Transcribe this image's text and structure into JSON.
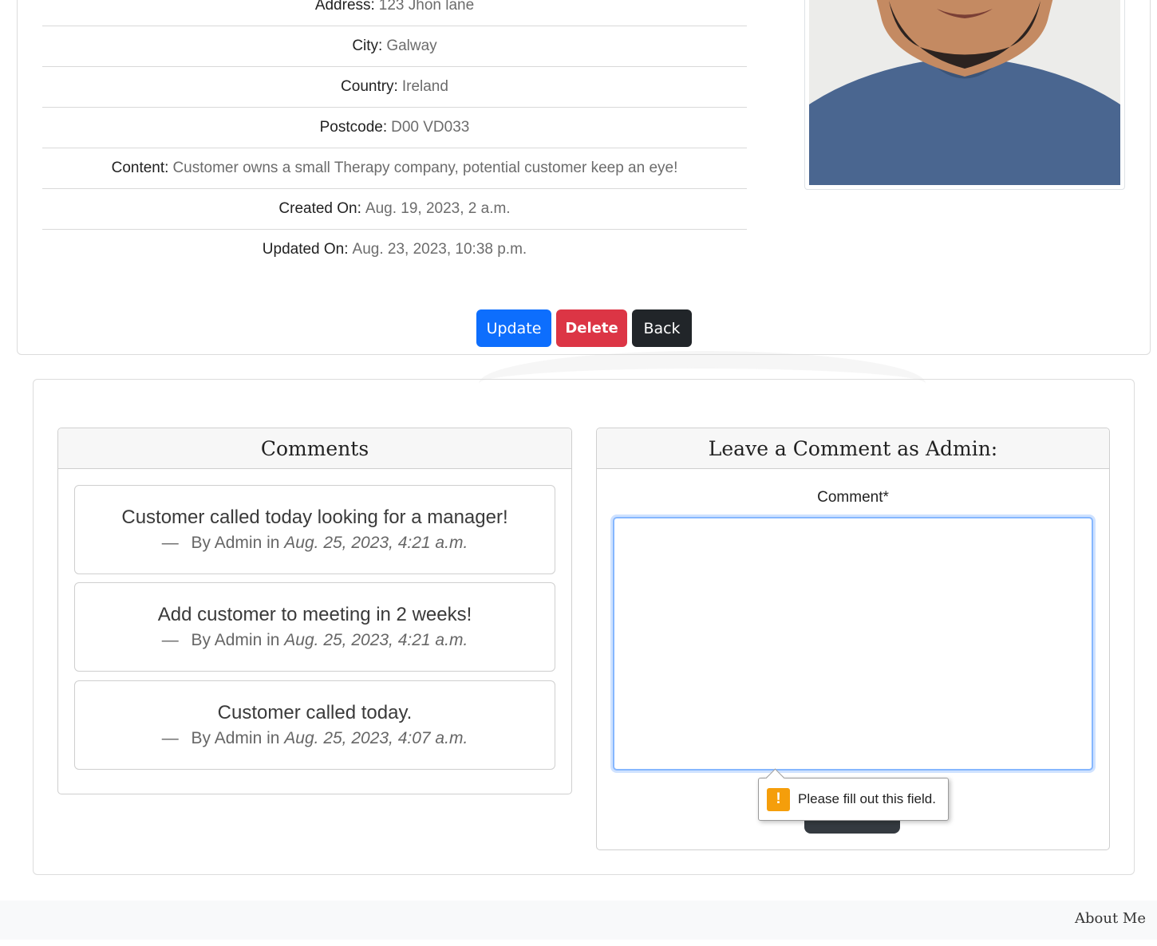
{
  "customer": {
    "fields": [
      {
        "label": "Address:",
        "value": "123 Jhon lane"
      },
      {
        "label": "City:",
        "value": "Galway"
      },
      {
        "label": "Country:",
        "value": "Ireland"
      },
      {
        "label": "Postcode:",
        "value": "D00 VD033"
      },
      {
        "label": "Content:",
        "value": "Customer owns a small Therapy company, potential customer keep an eye!"
      },
      {
        "label": "Created On:",
        "value": "Aug. 19, 2023, 2 a.m."
      },
      {
        "label": "Updated On:",
        "value": "Aug. 23, 2023, 10:38 p.m."
      }
    ],
    "actions": {
      "update": "Update",
      "delete": "Delete",
      "back": "Back"
    }
  },
  "comments": {
    "title": "Comments",
    "items": [
      {
        "body": "Customer called today looking for a manager!",
        "dash": "—",
        "by": "By Admin in",
        "date": "Aug. 25, 2023, 4:21 a.m."
      },
      {
        "body": "Add customer to meeting in 2 weeks!",
        "dash": "—",
        "by": "By Admin in",
        "date": "Aug. 25, 2023, 4:21 a.m."
      },
      {
        "body": "Customer called today.",
        "dash": "—",
        "by": "By Admin in",
        "date": "Aug. 25, 2023, 4:07 a.m."
      }
    ]
  },
  "comment_form": {
    "title": "Leave a Comment as Admin:",
    "label": "Comment*",
    "value": "",
    "validation_message": "Please fill out this field."
  },
  "footer": {
    "about": "About Me"
  },
  "colors": {
    "primary": "#0d6efd",
    "danger": "#dc3545",
    "dark": "#212529"
  }
}
